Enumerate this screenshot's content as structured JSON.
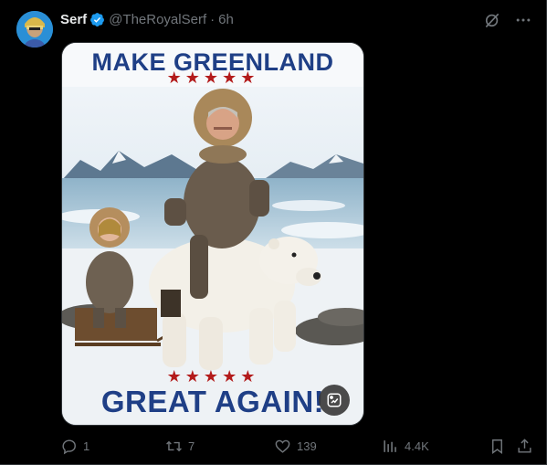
{
  "post": {
    "author_name": "Serf",
    "handle": "@TheRoyalSerf",
    "separator": "·",
    "time": "6h"
  },
  "poster": {
    "title_top": "MAKE GREENLAND",
    "title_bottom": "GREAT AGAIN!",
    "stars": "★★★★★"
  },
  "actions": {
    "replies": "1",
    "reposts": "7",
    "likes": "139",
    "views": "4.4K"
  },
  "icons": {
    "verified": "verified-badge-icon",
    "grok": "grok-icon",
    "more": "more-icon",
    "reply": "reply-icon",
    "repost": "repost-icon",
    "like": "like-icon",
    "views": "views-icon",
    "bookmark": "bookmark-icon",
    "share": "share-icon",
    "edit_image": "edit-image-icon"
  },
  "colors": {
    "background": "#000000",
    "text": "#e7e9ea",
    "muted": "#71767b",
    "verified": "#1d9bf0",
    "poster_title": "#1f3f86",
    "poster_stars": "#b31b1b"
  }
}
